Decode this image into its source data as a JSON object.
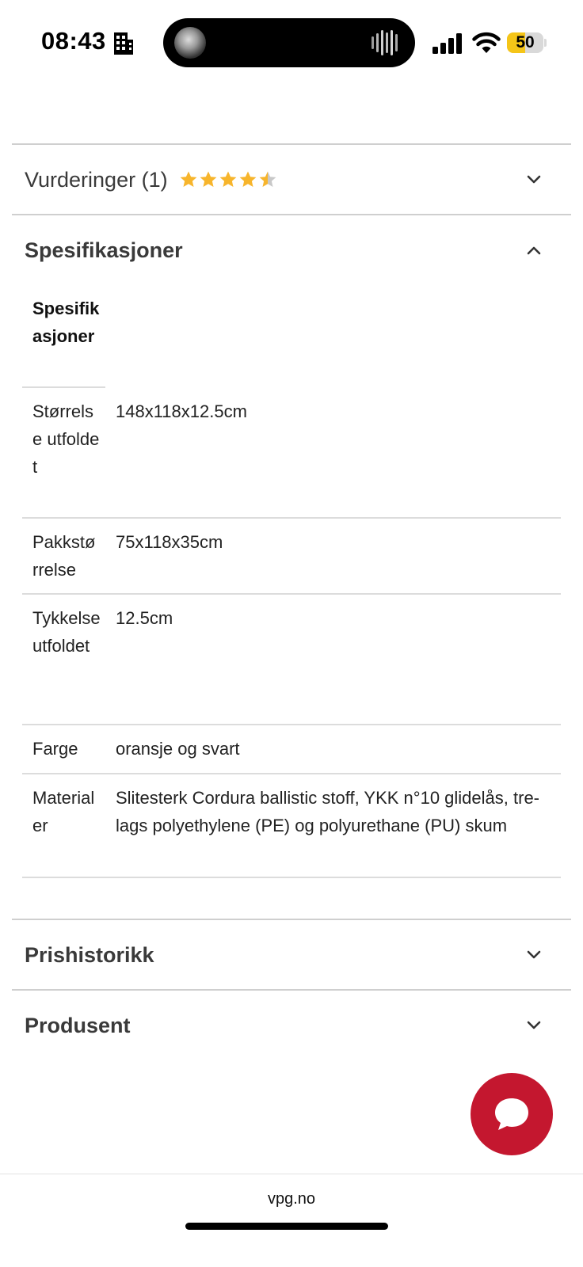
{
  "status_bar": {
    "time": "08:43",
    "battery_level": "50",
    "battery_fraction": 0.5,
    "icons": [
      "building-icon",
      "signal-icon",
      "wifi-icon",
      "battery-icon"
    ]
  },
  "sections": {
    "reviews": {
      "title": "Vurderinger (1)",
      "rating": 4.5,
      "max_rating": 5,
      "expanded": false
    },
    "specs": {
      "title": "Spesifikasjoner",
      "expanded": true
    },
    "price_history": {
      "title": "Prishistorikk",
      "expanded": false
    },
    "manufacturer": {
      "title": "Produsent",
      "expanded": false
    }
  },
  "spec_table": {
    "header": "Spesifikasjoner",
    "rows": [
      {
        "key": "Størrelse utfoldet",
        "value": "148x118x12.5cm"
      },
      {
        "key": "Pakkstørrelse",
        "value": "75x118x35cm"
      },
      {
        "key": "Tykkelse utfoldet",
        "value": "12.5cm"
      },
      {
        "key": "Farge",
        "value": "oransje og svart"
      },
      {
        "key": "Materialer",
        "value": "Slitesterk Cordura ballistic stoff, YKK n°10 glidelås, tre-lags polyethylene (PE) og polyurethane (PU) skum"
      }
    ]
  },
  "colors": {
    "accent_red": "#c4172f",
    "star_gold": "#f7b52c",
    "star_gray": "#c8c8c8",
    "battery_yellow": "#f5c518"
  },
  "browser": {
    "url": "vpg.no"
  }
}
